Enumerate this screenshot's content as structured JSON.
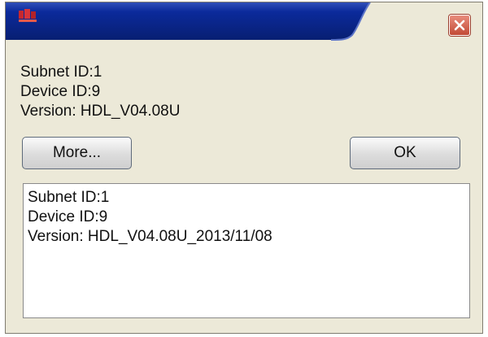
{
  "titlebar": {
    "title": "",
    "icon": "app-icon",
    "close_icon": "close-icon"
  },
  "info": {
    "subnet": "Subnet ID:1",
    "device": "Device ID:9",
    "version": "Version: HDL_V04.08U"
  },
  "buttons": {
    "more_label": "More...",
    "ok_label": "OK"
  },
  "details": {
    "subnet": "Subnet ID:1",
    "device": "Device ID:9",
    "version": "Version: HDL_V04.08U_2013/11/08"
  },
  "colors": {
    "titlebar_blue": "#0a2a8a",
    "window_bg": "#ece9d8",
    "close_red": "#c24a35"
  }
}
